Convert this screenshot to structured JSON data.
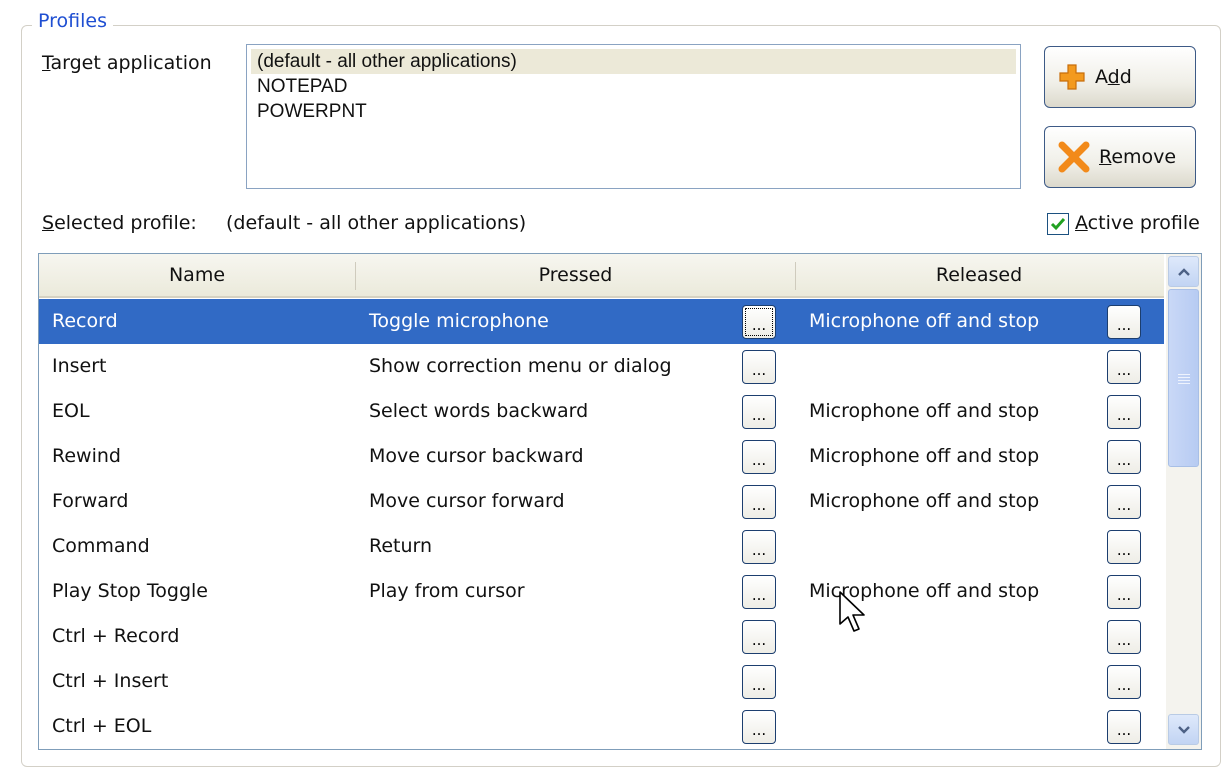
{
  "profiles": {
    "group_title": "Profiles",
    "target_label": {
      "u": "T",
      "rest": "arget application"
    },
    "applications": [
      "(default - all other applications)",
      "NOTEPAD",
      "POWERPNT"
    ],
    "selected_application_index": 0,
    "add_button": {
      "pre": "A",
      "u": "d",
      "rest": "d"
    },
    "remove_button": {
      "pre": "",
      "u": "R",
      "rest": "emove"
    },
    "selected_profile_label": {
      "u": "S",
      "rest": "elected profile:"
    },
    "selected_profile_value": "(default - all other applications)",
    "active_profile": {
      "u": "A",
      "rest": "ctive profile",
      "checked": true
    }
  },
  "grid": {
    "columns": [
      "Name",
      "Pressed",
      "Released"
    ],
    "ellipsis": "...",
    "rows": [
      {
        "name": "Record",
        "pressed": "Toggle microphone",
        "released": "Microphone off and stop",
        "selected": true
      },
      {
        "name": "Insert",
        "pressed": "Show correction menu or dialog",
        "released": ""
      },
      {
        "name": "EOL",
        "pressed": "Select words backward",
        "released": "Microphone off and stop"
      },
      {
        "name": "Rewind",
        "pressed": "Move cursor backward",
        "released": "Microphone off and stop"
      },
      {
        "name": "Forward",
        "pressed": "Move cursor forward",
        "released": "Microphone off and stop"
      },
      {
        "name": "Command",
        "pressed": "Return",
        "released": ""
      },
      {
        "name": "Play Stop Toggle",
        "pressed": "Play from cursor",
        "released": "Microphone off and stop"
      },
      {
        "name": "Ctrl + Record",
        "pressed": "",
        "released": ""
      },
      {
        "name": "Ctrl + Insert",
        "pressed": "",
        "released": ""
      },
      {
        "name": "Ctrl + EOL",
        "pressed": "",
        "released": ""
      }
    ]
  },
  "colors": {
    "group_title": "#1f4fd2",
    "selection": "#316ac5",
    "list_selection": "#ece9d8"
  },
  "icons": {
    "add": "plus-icon",
    "remove": "x-icon",
    "scroll_up": "chevron-up-icon",
    "scroll_down": "chevron-down-icon",
    "cursor": "mouse-pointer-icon"
  }
}
